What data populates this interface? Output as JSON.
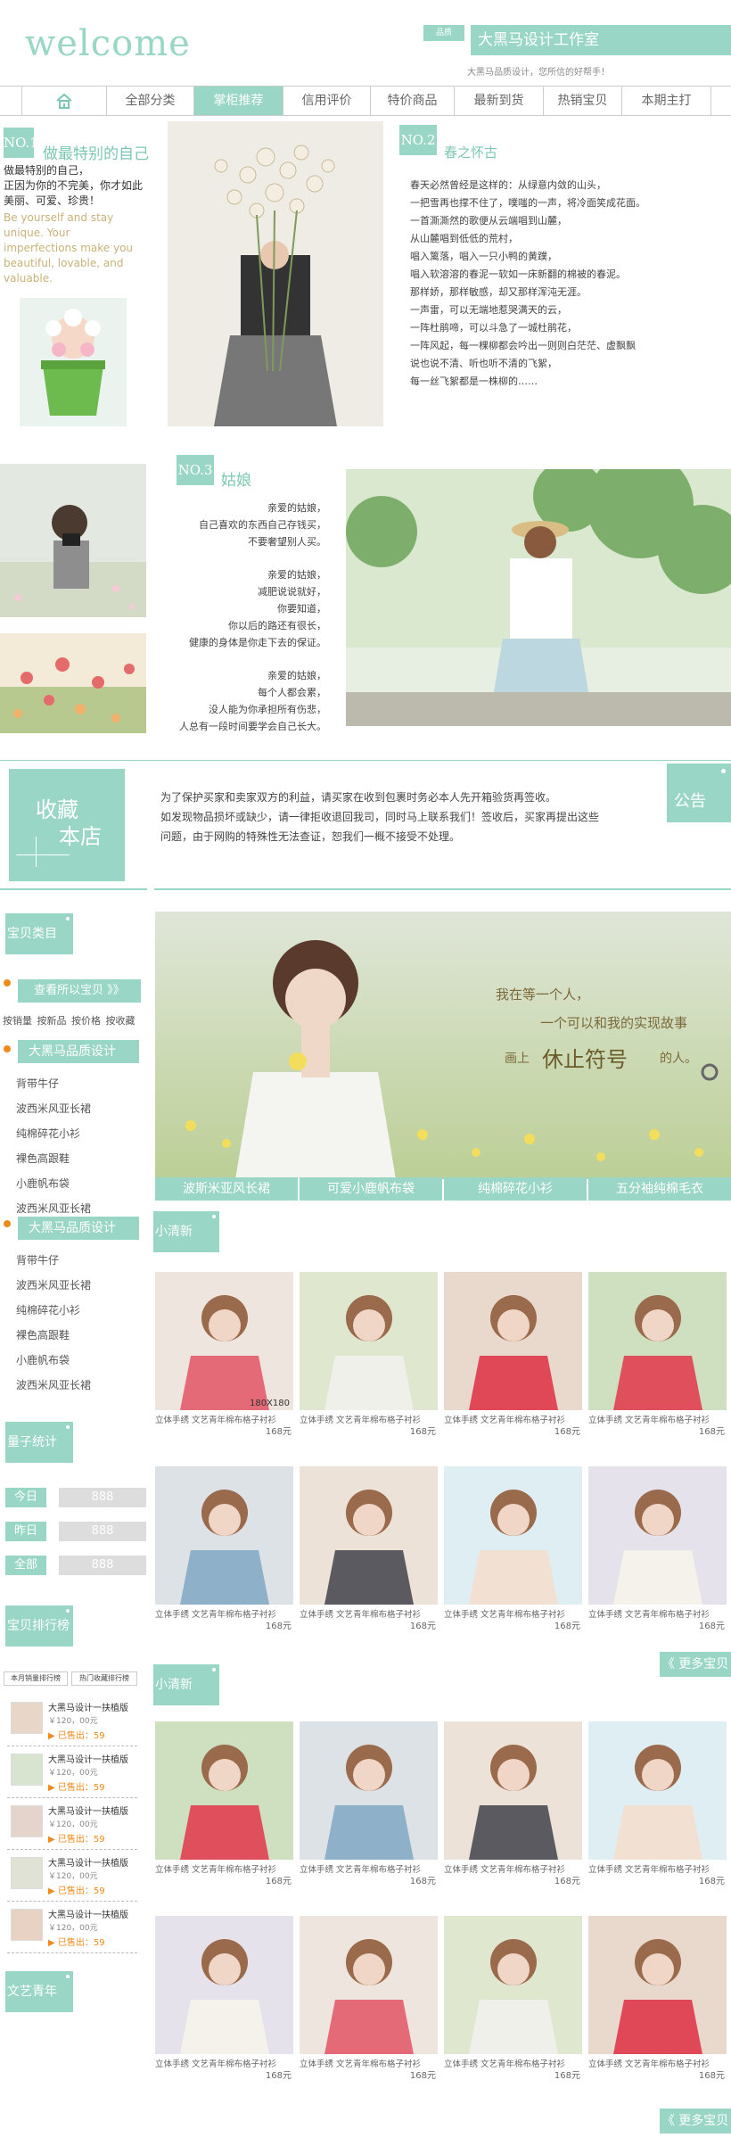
{
  "header": {
    "logo_text": "welcome",
    "shop_tag": "品质",
    "shop_name": "大黑马设计工作室",
    "slogan": "大黑马品质设计，您所信的好帮手！"
  },
  "nav": {
    "items": [
      {
        "label": "全部分类"
      },
      {
        "label": "掌柜推荐"
      },
      {
        "label": "信用评价"
      },
      {
        "label": "特价商品"
      },
      {
        "label": "最新到货"
      },
      {
        "label": "热销宝贝"
      },
      {
        "label": "本期主打"
      }
    ],
    "active": "掌柜推荐"
  },
  "feature1": {
    "no": "NO.1",
    "title": "做最特别的自己",
    "text": "做最特别的自己，\n正因为你的不完美，你才如此\n美丽、可爱、珍贵！",
    "english": "Be yourself and stay\nunique. Your\nimperfections make you\nbeautiful, lovable, and\nvaluable."
  },
  "feature2": {
    "no": "NO.2",
    "title": "春之怀古",
    "poem": [
      "春天必然曾经是这样的：从绿意内敛的山头，",
      "一把雪再也撑不住了，噗嗤的一声，将冷面笑成花面。",
      "一首澌澌然的歌便从云端唱到山麓，",
      "从山麓唱到低低的荒村，",
      "唱入篱落，唱入一只小鸭的黄蹼，",
      "唱入软溶溶的春泥一软如一床新翻的棉被的春泥。",
      "那样娇，那样敏感，却又那样浑沌无涯。",
      "一声雷，可以无端地惹哭满天的云，",
      "一阵杜鹃啼，可以斗急了一城杜鹃花，",
      "一阵风起，每一棵柳都会吟出一则则白茫茫、虚飘飘",
      "说也说不清、听也听不清的飞絮，",
      "每一丝飞絮都是一株柳的……"
    ]
  },
  "feature3": {
    "no": "NO.3",
    "title": "姑娘",
    "stanzas": [
      [
        "亲爱的姑娘，",
        "自己喜欢的东西自己存钱买，",
        "不要奢望别人买。"
      ],
      [
        "亲爱的姑娘，",
        "减肥说说就好，",
        "你要知道，",
        "你以后的路还有很长，",
        "健康的身体是你走下去的保证。"
      ],
      [
        "亲爱的姑娘，",
        "每个人都会累，",
        "没人能为你承担所有伤悲，",
        "人总有一段时间要学会自己长大。"
      ]
    ]
  },
  "notice": {
    "fav_line1": "收藏",
    "fav_line2": "本店",
    "text_lines": [
      "为了保护买家和卖家双方的利益，请买家在收到包裹时务必本人先开箱验货再签收。",
      "如发现物品损坏或缺少，请一律拒收退回我司，同时马上联系我们！签收后，买家再提出这些",
      "问题，由于网购的特殊性无法查证，恕我们一概不接受不处理。"
    ],
    "label": "公告"
  },
  "sidebar": {
    "category_title": "宝贝类目",
    "view_all": "查看所以宝贝 》》",
    "subcats": [
      "按销量",
      "按新品",
      "按价格",
      "按收藏"
    ],
    "group_title": "大黑马品质设计",
    "group1": [
      "背带牛仔",
      "波西米风亚长裙",
      "纯棉碎花小衫",
      "裸色高跟鞋",
      "小鹿帆布袋",
      "波西米风亚长裙"
    ],
    "group2": [
      "背带牛仔",
      "波西米风亚长裙",
      "纯棉碎花小衫",
      "裸色高跟鞋",
      "小鹿帆布袋",
      "波西米风亚长裙"
    ],
    "stats_title": "量子统计",
    "stats": [
      {
        "label": "今日",
        "value": "888"
      },
      {
        "label": "昨日",
        "value": "888"
      },
      {
        "label": "全部",
        "value": "888"
      }
    ],
    "rank_title": "宝贝排行榜",
    "rank_tabs": [
      "本月销量排行榜",
      "热门收藏排行榜"
    ],
    "rank_items": [
      {
        "title": "大黑马设计一扶植版",
        "price": "￥120，00元",
        "sold": "已售出：59"
      },
      {
        "title": "大黑马设计一扶植版",
        "price": "￥120，00元",
        "sold": "已售出：59"
      },
      {
        "title": "大黑马设计一扶植版",
        "price": "￥120，00元",
        "sold": "已售出：59"
      },
      {
        "title": "大黑马设计一扶植版",
        "price": "￥120，00元",
        "sold": "已售出：59"
      },
      {
        "title": "大黑马设计一扶植版",
        "price": "￥120，00元",
        "sold": "已售出：59"
      }
    ],
    "bottom_title": "文艺青年"
  },
  "banner": {
    "line1": "我在等一个人，",
    "line2": "一个可以和我的实现故事",
    "line3_pre": "画上",
    "line3_big": "休止符号",
    "line3_post": "的人。",
    "captions": [
      "波斯米亚风长裙",
      "可爱小鹿帆布袋",
      "纯棉碎花小衫",
      "五分袖纯棉毛衣"
    ]
  },
  "section1": {
    "title": "小清新",
    "size_label": "180X180",
    "more": "《 更多宝贝",
    "products": [
      {
        "title": "立体手绣 文艺青年棉布格子衬衫",
        "price": "168元"
      },
      {
        "title": "立体手绣 文艺青年棉布格子衬衫",
        "price": "168元"
      },
      {
        "title": "立体手绣 文艺青年棉布格子衬衫",
        "price": "168元"
      },
      {
        "title": "立体手绣 文艺青年棉布格子衬衫",
        "price": "168元"
      },
      {
        "title": "立体手绣 文艺青年棉布格子衬衫",
        "price": "168元"
      },
      {
        "title": "立体手绣 文艺青年棉布格子衬衫",
        "price": "168元"
      },
      {
        "title": "立体手绣 文艺青年棉布格子衬衫",
        "price": "168元"
      },
      {
        "title": "立体手绣 文艺青年棉布格子衬衫",
        "price": "168元"
      }
    ]
  },
  "section2": {
    "title": "小清新",
    "more": "《 更多宝贝",
    "products": [
      {
        "title": "立体手绣 文艺青年棉布格子衬衫",
        "price": "168元"
      },
      {
        "title": "立体手绣 文艺青年棉布格子衬衫",
        "price": "168元"
      },
      {
        "title": "立体手绣 文艺青年棉布格子衬衫",
        "price": "168元"
      },
      {
        "title": "立体手绣 文艺青年棉布格子衬衫",
        "price": "168元"
      },
      {
        "title": "立体手绣 文艺青年棉布格子衬衫",
        "price": "168元"
      },
      {
        "title": "立体手绣 文艺青年棉布格子衬衫",
        "price": "168元"
      },
      {
        "title": "立体手绣 文艺青年棉布格子衬衫",
        "price": "168元"
      },
      {
        "title": "立体手绣 文艺青年棉布格子衬衫",
        "price": "168元"
      }
    ]
  },
  "colors": {
    "accent": "#9ad6c5",
    "text": "#555555",
    "sale": "#f08a1a",
    "gold": "#c8b27a"
  }
}
